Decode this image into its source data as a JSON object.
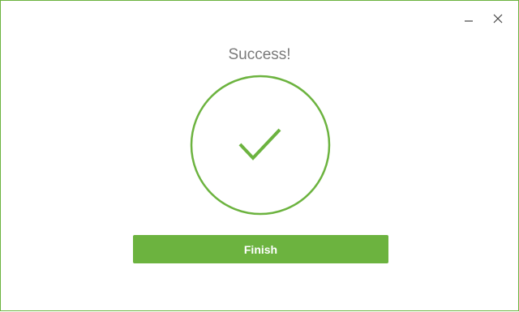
{
  "window": {
    "controls": {
      "minimize_icon": "minimize-icon",
      "close_icon": "close-icon"
    }
  },
  "main": {
    "heading": "Success!",
    "status_icon": "checkmark-icon",
    "finish_label": "Finish"
  },
  "colors": {
    "accent": "#6cb33f",
    "heading_text": "#7a7a7a",
    "control_icons": "#444444"
  }
}
